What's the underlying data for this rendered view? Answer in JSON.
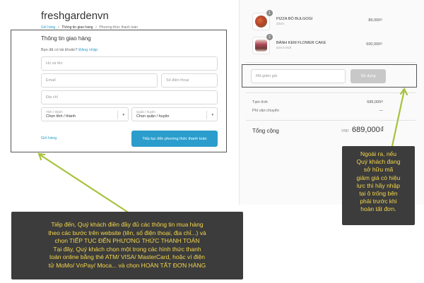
{
  "brand": {
    "logo": "freshgardenvn"
  },
  "breadcrumb": {
    "items": [
      "Giỏ hàng",
      "Thông tin giao hàng",
      "Phương thức thanh toán"
    ],
    "separator": ">"
  },
  "shipping": {
    "title": "Thông tin giao hàng",
    "login_prompt": "Bạn đã có tài khoản?",
    "login_link": "Đăng nhập",
    "fullname_placeholder": "Họ và tên",
    "email_placeholder": "Email",
    "phone_placeholder": "Số điện thoại",
    "address_placeholder": "Địa chỉ",
    "province": {
      "label": "Tỉnh / thành",
      "value": "Chọn tỉnh / thành"
    },
    "district": {
      "label": "Quận / huyện",
      "value": "Chọn quận / huyện"
    },
    "back_link": "Giỏ hàng",
    "continue_button": "Tiếp tục đến phương thức thanh toán"
  },
  "cart": {
    "items": [
      {
        "qty": "1",
        "name": "PIZZA BÒ BULGOGI",
        "variant": "22cm",
        "price": "89,000₫"
      },
      {
        "qty": "2",
        "name": "BÁNH KEM FLOWER CAKE",
        "variant": "size 5 inch",
        "price": "600,000₫"
      }
    ],
    "discount_placeholder": "Mã giảm giá",
    "apply_button": "Sử dụng",
    "subtotal_label": "Tạm tính",
    "subtotal_value": "689,000₫",
    "shipping_label": "Phí vận chuyển",
    "shipping_value": "—",
    "total_label": "Tổng cộng",
    "total_currency": "VND",
    "total_value": "689,000₫"
  },
  "callouts": {
    "main": [
      "Tiếp đến, Quý khách điền đầy đủ các thông tin mua hàng",
      "theo các bước trên website (tên, số điện thoại, địa chỉ...) và",
      "chọn TIẾP TỤC ĐẾN PHƯƠNG THỨC THANH TOÁN",
      "Tại đây, Quý khách chọn một trong các hình thức thanh",
      "toán online bằng thẻ ATM/ VISA/ MasterCard, hoặc ví điện",
      "tử MoMo/ VnPay/ Moca... và chọn HOÀN TẤT ĐƠN HÀNG"
    ],
    "right": [
      "Ngoài ra, nếu",
      "Quý khách đang",
      "sở hữu mã",
      "giảm giá có hiệu",
      "lực thì hãy nhập",
      "tại ô trống bên",
      "phải trước khi",
      "hoàn tất đơn."
    ]
  },
  "colors": {
    "accent": "#2a9dcc",
    "callout_bg": "#3c3c3c",
    "callout_text": "#f5d74a",
    "arrow": "#a6c33c"
  }
}
